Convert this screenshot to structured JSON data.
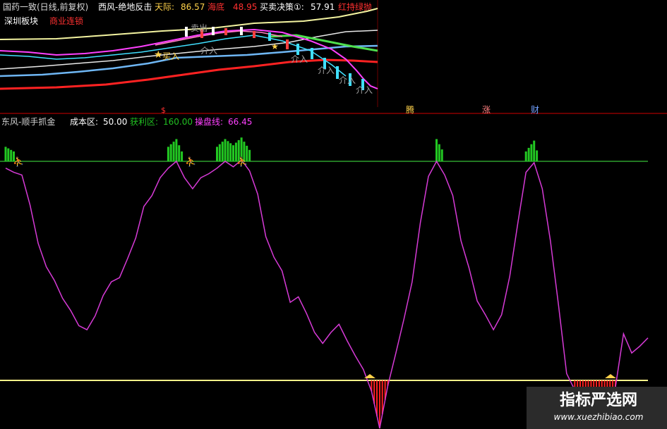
{
  "top_panel": {
    "title": "国药一致(日线,前复权)",
    "indicator_name": "西风-绝地反击",
    "tianji_label": "天际:",
    "tianji_value": "86.57",
    "haidi_label": "海底",
    "haidi_value": "48.95",
    "maimai_label": "买卖决策①:",
    "maimai_value": "57.91",
    "hongjin_label": "红持绿抛",
    "block_label_1": "深圳板块",
    "block_label_2": "商业连锁",
    "annotations": [
      "买入",
      "介入",
      "介入",
      "介入",
      "介入",
      "卖出",
      "介入"
    ],
    "colors": {
      "title": "#d8d8d8",
      "indicator": "#ffffff",
      "tianji": "#ffd24a",
      "haidi": "#ff3030",
      "maimai": "#ffffff",
      "hongjin": "#ff3030",
      "block1": "#ffffff",
      "block2": "#ff3030"
    }
  },
  "separator_marks": {
    "s_mark": "$",
    "items": [
      "腾",
      "涨",
      "财"
    ]
  },
  "bottom_panel": {
    "indicator_name": "东风-顺手抓金",
    "cost_label": "成本区:",
    "cost_value": "50.00",
    "profit_label": "获利区:",
    "profit_value": "160.00",
    "line_label": "操盘线:",
    "line_value": "66.45",
    "colors": {
      "name": "#d0d0d0",
      "cost": "#ffffff",
      "profit": "#21c021",
      "line": "#ff40ff",
      "upper_line": "#2ea02e",
      "lower_line": "#fff28a",
      "red_bars": "#ff2020",
      "green_bars": "#22c822"
    }
  },
  "chart_data": {
    "type": "line",
    "series": [
      {
        "values": [
          155,
          152,
          150,
          128,
          100,
          83,
          73,
          60,
          51,
          40,
          37,
          47,
          62,
          72,
          75,
          89,
          104,
          127,
          135,
          148,
          155,
          160,
          148,
          140,
          148,
          151,
          155,
          160,
          156,
          161,
          153,
          136,
          105,
          90,
          80,
          57,
          61,
          49,
          35,
          27,
          35,
          41,
          29,
          18,
          8,
          -8,
          -35,
          -4,
          20,
          45,
          72,
          115,
          149,
          160,
          150,
          135,
          102,
          82,
          58,
          48,
          37,
          48,
          76,
          115,
          152,
          159,
          140,
          102,
          55,
          5,
          -7,
          -7,
          -7,
          -7,
          -5,
          -5,
          34,
          20,
          25,
          31
        ]
      }
    ],
    "upper_level": 160,
    "lower_level": 0,
    "grid": false
  },
  "watermark": {
    "title": "指标严选网",
    "url": "www.xuezhibiao.com"
  }
}
